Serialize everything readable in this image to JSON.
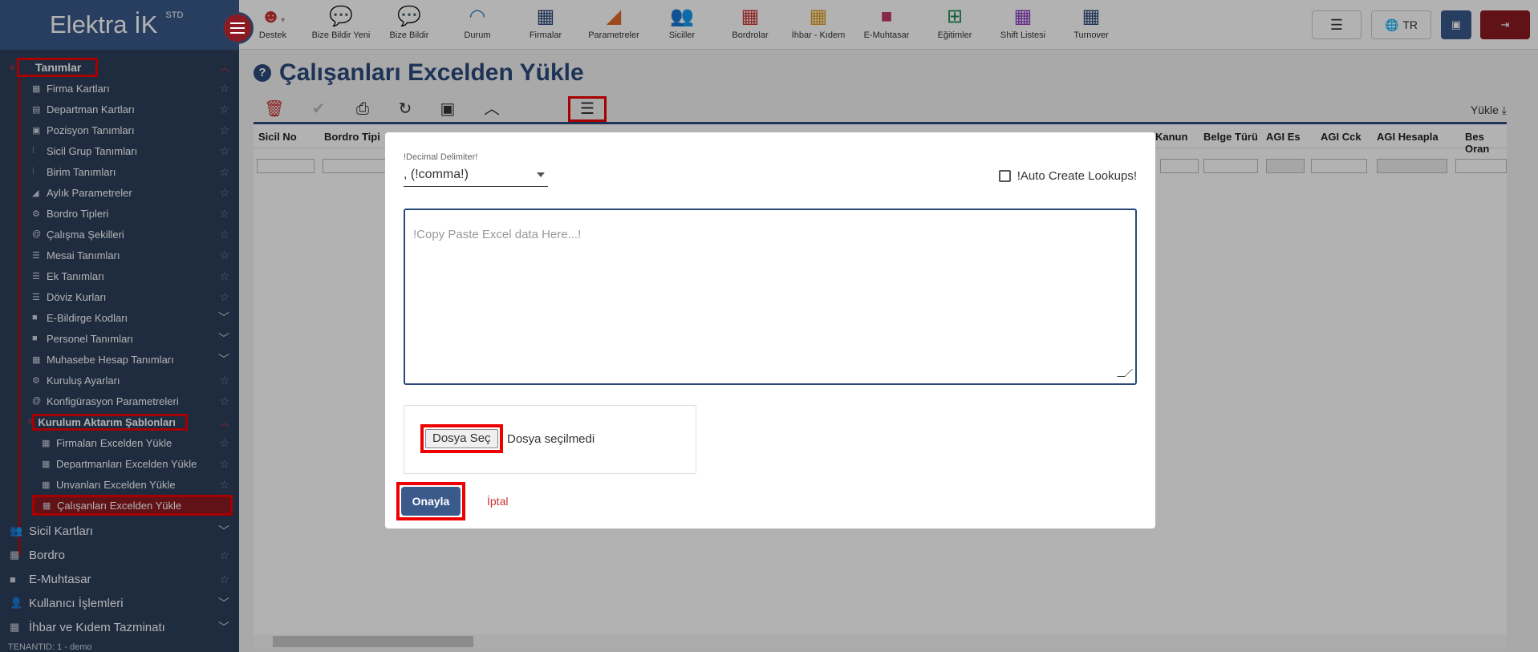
{
  "brand": {
    "name": "Elektra İK",
    "edition": "STD"
  },
  "topbar": {
    "items": [
      {
        "label": "Destek",
        "icon": "support-avatar-icon"
      },
      {
        "label": "Bize Bildir Yeni",
        "icon": "chat-icon"
      },
      {
        "label": "Bize Bildir",
        "icon": "chat-icon"
      },
      {
        "label": "Durum",
        "icon": "wifi-icon"
      },
      {
        "label": "Firmalar",
        "icon": "building-icon"
      },
      {
        "label": "Parametreler",
        "icon": "triangle-icon"
      },
      {
        "label": "Siciller",
        "icon": "users-icon"
      },
      {
        "label": "Bordrolar",
        "icon": "calculator-icon"
      },
      {
        "label": "İhbar - Kıdem",
        "icon": "calculator-icon"
      },
      {
        "label": "E-Muhtasar",
        "icon": "folder-icon"
      },
      {
        "label": "Eğitimler",
        "icon": "add-box-icon"
      },
      {
        "label": "Shift Listesi",
        "icon": "calendar-icon"
      },
      {
        "label": "Turnover",
        "icon": "calculator-icon"
      }
    ],
    "lang": "TR"
  },
  "sidebar": {
    "section": "Tanımlar",
    "items": [
      {
        "label": "Firma Kartları",
        "icon": "building-icon"
      },
      {
        "label": "Departman Kartları",
        "icon": "table-icon"
      },
      {
        "label": "Pozisyon Tanımları",
        "icon": "id-card-icon"
      },
      {
        "label": "Sicil Grup Tanımları",
        "icon": "sliders-icon"
      },
      {
        "label": "Birim Tanımları",
        "icon": "sliders-icon"
      },
      {
        "label": "Aylık Parametreler",
        "icon": "signal-icon"
      },
      {
        "label": "Bordro Tipleri",
        "icon": "gear-icon"
      },
      {
        "label": "Çalışma Şekilleri",
        "icon": "at-icon"
      },
      {
        "label": "Mesai Tanımları",
        "icon": "list-icon"
      },
      {
        "label": "Ek Tanımları",
        "icon": "list-icon"
      },
      {
        "label": "Döviz Kurları",
        "icon": "list-icon"
      },
      {
        "label": "E-Bildirge Kodları",
        "icon": "folder-icon"
      },
      {
        "label": "Personel Tanımları",
        "icon": "folder-icon"
      },
      {
        "label": "Muhasebe Hesap Tanımları",
        "icon": "calculator-icon"
      },
      {
        "label": "Kuruluş Ayarları",
        "icon": "gear-icon"
      },
      {
        "label": "Konfigürasyon Parametreleri",
        "icon": "at-icon"
      }
    ],
    "subsection": "Kurulum Aktarım Şablonları",
    "subitems": [
      {
        "label": "Firmaları Excelden Yükle"
      },
      {
        "label": "Departmanları Excelden Yükle"
      },
      {
        "label": "Unvanları Excelden Yükle"
      },
      {
        "label": "Çalışanları Excelden Yükle"
      }
    ],
    "bottom": [
      {
        "label": "Sicil Kartları"
      },
      {
        "label": "Bordro"
      },
      {
        "label": "E-Muhtasar"
      },
      {
        "label": "Kullanıcı İşlemleri"
      },
      {
        "label": "İhbar ve Kıdem Tazminatı"
      }
    ],
    "tenant": "TENANTID: 1 - demo"
  },
  "page": {
    "title": "Çalışanları Excelden Yükle",
    "upload_label": "Yükle"
  },
  "grid": {
    "columns": [
      "Sicil No",
      "Bordro Tipi",
      "Kanun",
      "Belge Türü",
      "AGI Es",
      "AGI Cck",
      "AGI Hesapla",
      "Bes Oran"
    ]
  },
  "modal": {
    "delimiter_label": "!Decimal Delimiter!",
    "delimiter_value": ", (!comma!)",
    "auto_create_label": "!Auto Create Lookups!",
    "textarea_placeholder": "!Copy Paste Excel data Here...!",
    "file_button": "Dosya Seç",
    "file_status": "Dosya seçilmedi",
    "ok_label": "Onayla",
    "cancel_label": "İptal"
  },
  "colors": {
    "primary": "#2b4a7c",
    "accent": "#8b1a22",
    "sidebar": "#2d3f5c",
    "highlight": "#ff0000"
  }
}
